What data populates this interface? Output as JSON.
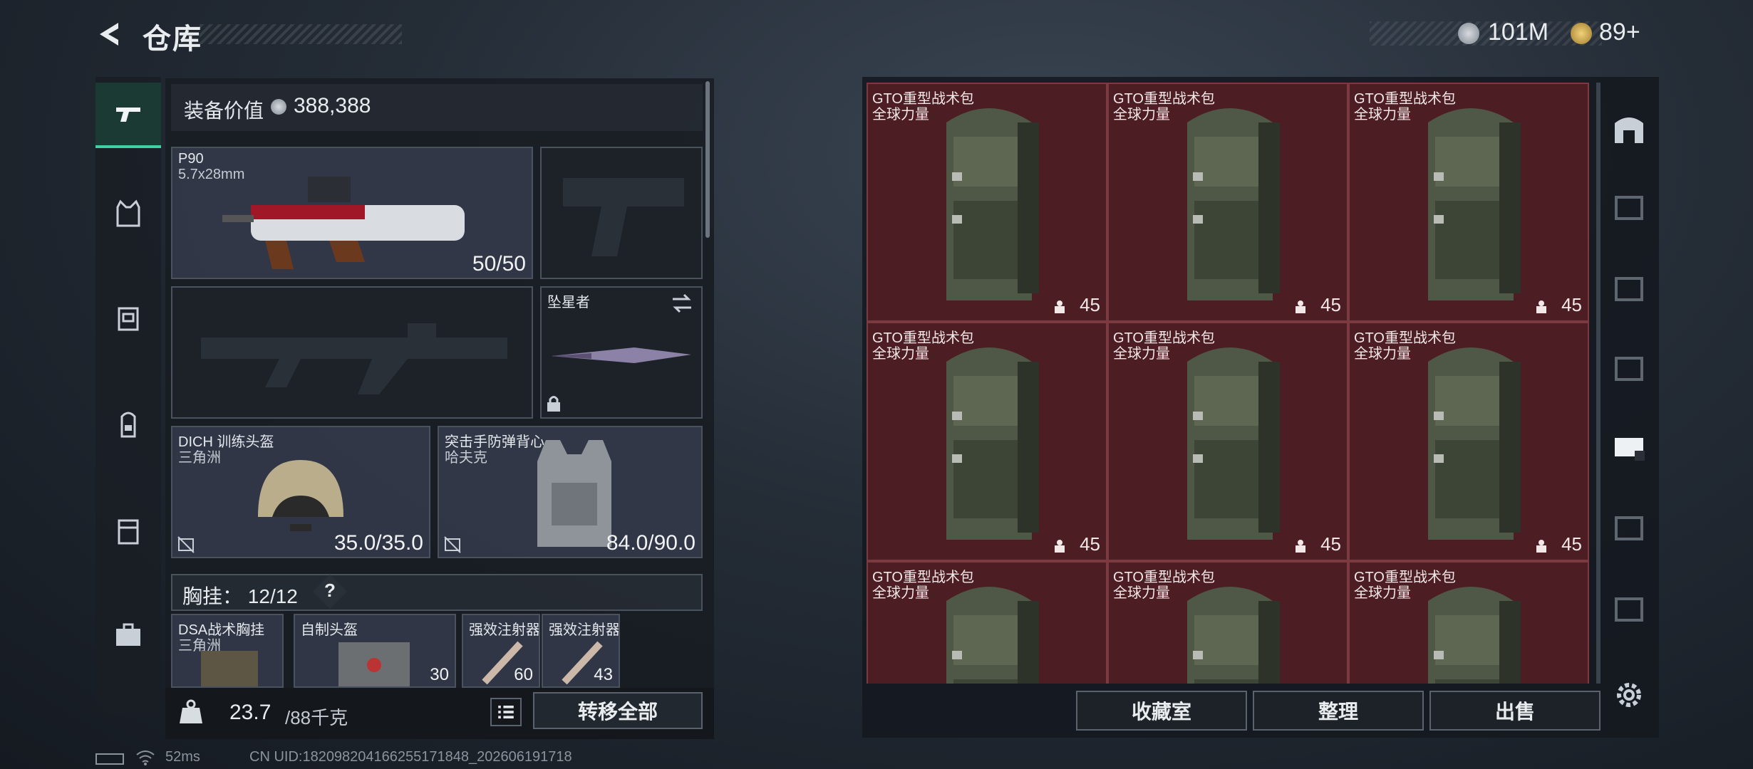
{
  "header": {
    "title": "仓库",
    "currencies": [
      {
        "icon": "silver-coin-icon",
        "value": "101M"
      },
      {
        "icon": "gold-coin-icon",
        "value": "89+"
      }
    ]
  },
  "categories": [
    {
      "icon": "pistol-icon",
      "active": true
    },
    {
      "icon": "vest-icon"
    },
    {
      "icon": "chest-rig-icon"
    },
    {
      "icon": "backpack-icon"
    },
    {
      "icon": "container-icon"
    },
    {
      "icon": "briefcase-icon"
    }
  ],
  "equipment": {
    "value_label": "装备价值",
    "value": "388,388",
    "primary": {
      "name": "P90",
      "ammo": "5.7x28mm",
      "count": "50/50"
    },
    "melee": {
      "name": "坠星者"
    },
    "helmet": {
      "name": "DICH 训练头盔",
      "brand": "三角洲",
      "durability": "35.0/35.0"
    },
    "armor": {
      "name": "突击手防弹背心",
      "brand": "哈夫克",
      "durability": "84.0/90.0"
    },
    "rig": {
      "label": "胸挂：",
      "capacity": "12/12",
      "help": "?"
    },
    "rig_items": [
      {
        "name": "DSA战术胸挂",
        "sub": "三角洲"
      },
      {
        "name": "自制头盔",
        "count": "30"
      },
      {
        "name": "强效注射器",
        "count": "60"
      },
      {
        "name": "强效注射器",
        "count": "43"
      }
    ],
    "weight": "23.7",
    "weight_max": "/88千克",
    "transfer_label": "转移全部"
  },
  "grid": {
    "items": [
      {
        "name": "GTO重型战术包",
        "sub": "全球力量",
        "count": "45"
      },
      {
        "name": "GTO重型战术包",
        "sub": "全球力量",
        "count": "45"
      },
      {
        "name": "GTO重型战术包",
        "sub": "全球力量",
        "count": "45"
      },
      {
        "name": "GTO重型战术包",
        "sub": "全球力量",
        "count": "45"
      },
      {
        "name": "GTO重型战术包",
        "sub": "全球力量",
        "count": "45"
      },
      {
        "name": "GTO重型战术包",
        "sub": "全球力量",
        "count": "45"
      },
      {
        "name": "GTO重型战术包",
        "sub": "全球力量",
        "count": ""
      },
      {
        "name": "GTO重型战术包",
        "sub": "全球力量",
        "count": ""
      },
      {
        "name": "GTO重型战术包",
        "sub": "全球力量",
        "count": ""
      }
    ],
    "buttons": {
      "collect": "收藏室",
      "sort": "整理",
      "sell": "出售"
    }
  },
  "status": {
    "ping": "52ms",
    "uid": "CN UID:182098204166255171848_202606191718"
  },
  "colors": {
    "accent": "#3fd1a3",
    "cell_bg": "#4c1d22",
    "cell_border": "#7b3a40"
  }
}
